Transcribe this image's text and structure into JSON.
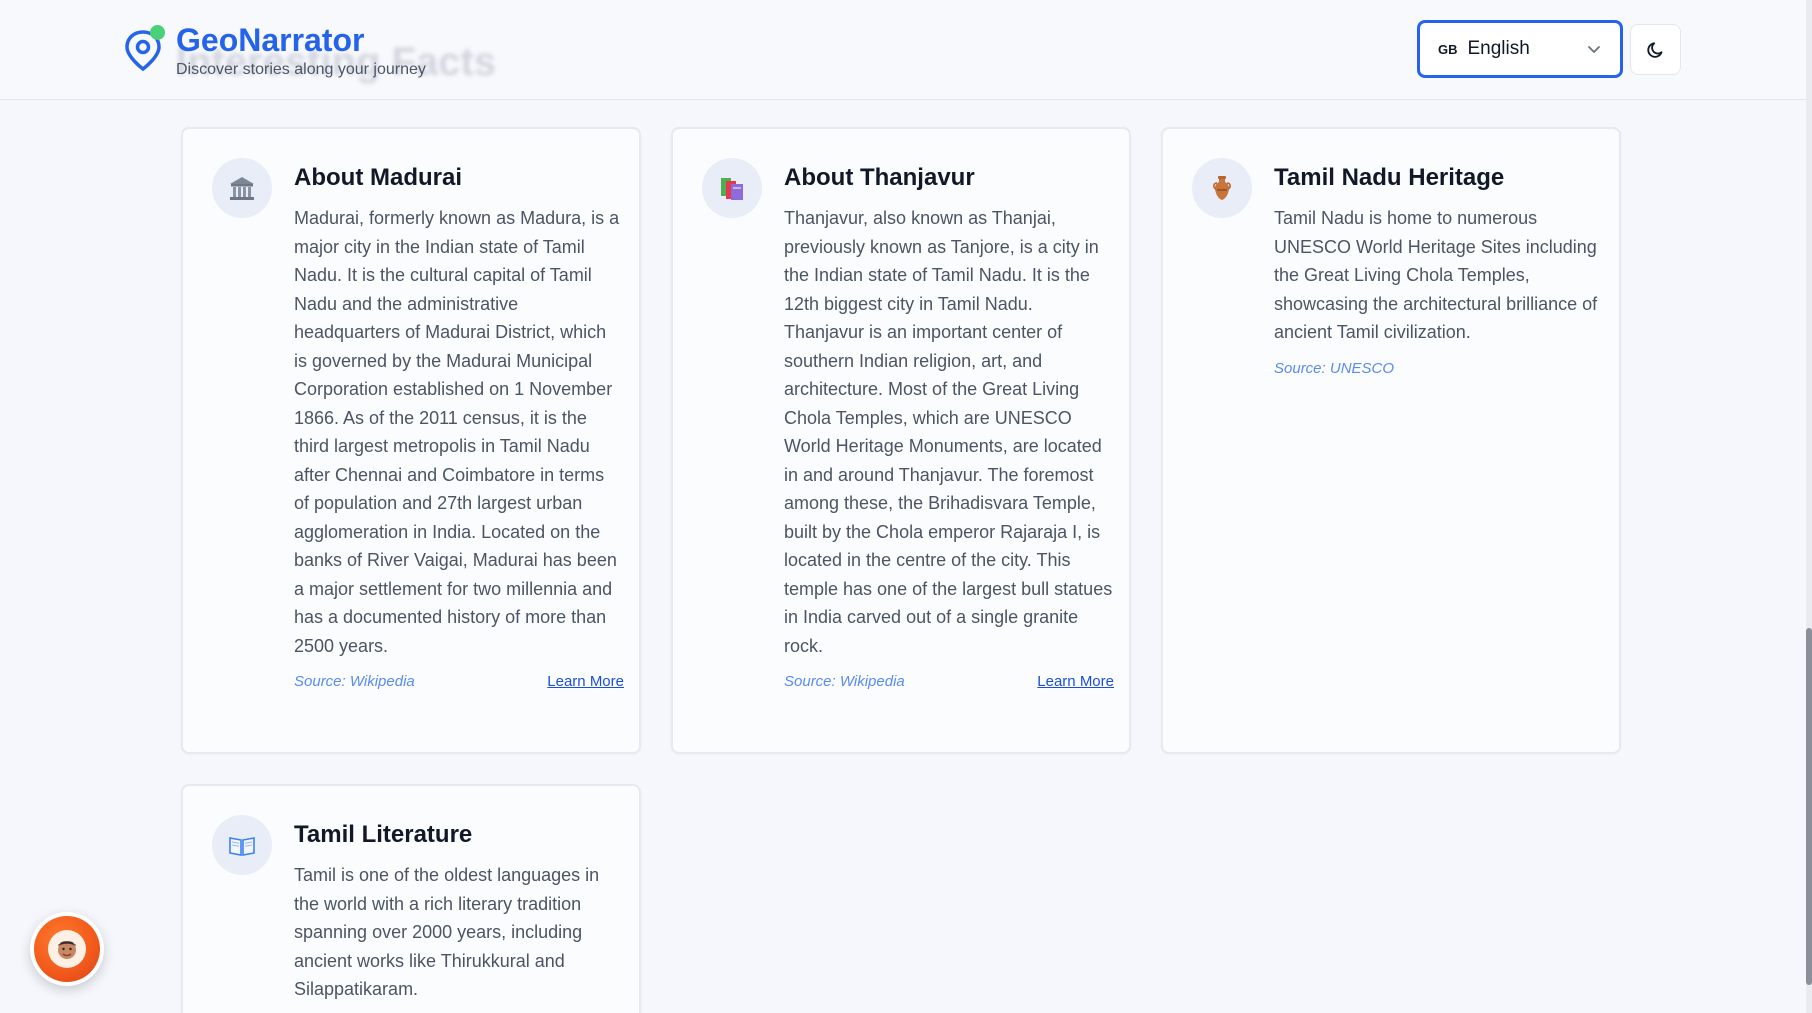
{
  "header": {
    "brand_title": "GeoNarrator",
    "brand_tagline": "Discover stories along your journey",
    "ghost_heading": "Interesting Facts",
    "language": {
      "flag": "GB",
      "selected": "English"
    },
    "theme_toggle_icon": "moon-icon"
  },
  "cards": [
    {
      "icon": "museum-icon",
      "title": "About Madurai",
      "text": "Madurai, formerly known as Madura, is a major city in the Indian state of Tamil Nadu. It is the cultural capital of Tamil Nadu and the administrative headquarters of Madurai District, which is governed by the Madurai Municipal Corporation established on 1 November 1866. As of the 2011 census, it is the third largest metropolis in Tamil Nadu after Chennai and Coimbatore in terms of population and 27th largest urban agglomeration in India. Located on the banks of River Vaigai, Madurai has been a major settlement for two millennia and has a documented history of more than 2500 years.",
      "source": "Source: Wikipedia",
      "link": "Learn More"
    },
    {
      "icon": "books-icon",
      "title": "About Thanjavur",
      "text": "Thanjavur, also known as Thanjai, previously known as Tanjore, is a city in the Indian state of Tamil Nadu. It is the 12th biggest city in Tamil Nadu. Thanjavur is an important center of southern Indian religion, art, and architecture. Most of the Great Living Chola Temples, which are UNESCO World Heritage Monuments, are located in and around Thanjavur. The foremost among these, the Brihadisvara Temple, built by the Chola emperor Rajaraja I, is located in the centre of the city. This temple has one of the largest bull statues in India carved out of a single granite rock.",
      "source": "Source: Wikipedia",
      "link": "Learn More"
    },
    {
      "icon": "amphora-icon",
      "title": "Tamil Nadu Heritage",
      "text": "Tamil Nadu is home to numerous UNESCO World Heritage Sites including the Great Living Chola Temples, showcasing the architectural brilliance of ancient Tamil civilization.",
      "source": "Source: UNESCO"
    },
    {
      "icon": "open-book-icon",
      "title": "Tamil Literature",
      "text": "Tamil is one of the oldest languages in the world with a rich literary tradition spanning over 2000 years, including ancient works like Thirukkural and Silappatikaram."
    }
  ],
  "assistant": {
    "icon": "avatar-icon"
  }
}
